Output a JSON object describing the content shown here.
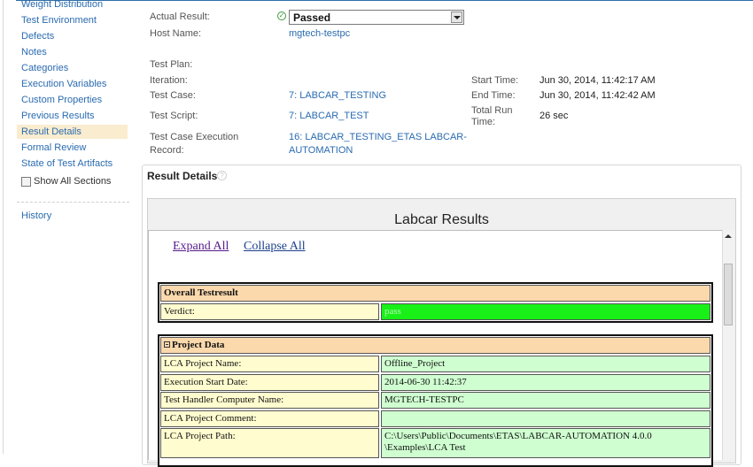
{
  "sidebar": {
    "items": [
      {
        "label": "Weight Distribution"
      },
      {
        "label": "Test Environment"
      },
      {
        "label": "Defects"
      },
      {
        "label": "Notes"
      },
      {
        "label": "Categories"
      },
      {
        "label": "Execution Variables"
      },
      {
        "label": "Custom Properties"
      },
      {
        "label": "Previous Results"
      },
      {
        "label": "Result Details"
      },
      {
        "label": "Formal Review"
      },
      {
        "label": "State of Test Artifacts"
      }
    ],
    "active": "Result Details",
    "show_all_label": "Show All Sections",
    "history_label": "History"
  },
  "fields": {
    "actual_result_label": "Actual Result:",
    "actual_result_value": "Passed",
    "host_name_label": "Host Name:",
    "host_name_value": "mgtech-testpc",
    "test_plan_label": "Test Plan:",
    "iteration_label": "Iteration:",
    "test_case_label": "Test Case:",
    "test_case_value": "7: LABCAR_TESTING",
    "test_script_label": "Test Script:",
    "test_script_value": "7: LABCAR_TEST",
    "tcer_label_1": "Test Case Execution",
    "tcer_label_2": "Record:",
    "tcer_value_1": "16: LABCAR_TESTING_ETAS LABCAR-",
    "tcer_value_2": "AUTOMATION",
    "start_time_label": "Start Time:",
    "start_time_value": "Jun 30, 2014, 11:42:17 AM",
    "end_time_label": "End Time:",
    "end_time_value": "Jun 30, 2014, 11:42:42 AM",
    "total_run_label_1": "Total Run",
    "total_run_label_2": "Time:",
    "total_run_value": "26 sec"
  },
  "result_details": {
    "title": "Result Details",
    "help": "?",
    "frame_title": "Labcar Results",
    "expand_all": "Expand All",
    "collapse_all": "Collapse All",
    "overall": {
      "header": "Overall Testresult",
      "verdict_label": "Verdict:",
      "verdict_value": "pass"
    },
    "project": {
      "header": "Project Data",
      "rows": [
        {
          "label": "LCA Project Name:",
          "value": "Offline_Project"
        },
        {
          "label": "Execution Start Date:",
          "value": "2014-06-30 11:42:37"
        },
        {
          "label": "Test Handler Computer Name:",
          "value": "MGTECH-TESTPC"
        },
        {
          "label": "LCA Project Comment:",
          "value": ""
        },
        {
          "label": "LCA Project Path:",
          "value": "C:\\Users\\Public\\Documents\\ETAS\\LABCAR-AUTOMATION 4.0.0",
          "value2": "\\Examples\\LCA Test"
        }
      ]
    }
  },
  "colors": {
    "link": "#2a6bb0",
    "active_bg": "#f9eccf",
    "header_bg": "#fbd9ad",
    "key_bg": "#fffccf",
    "value_bg": "#cfffd0",
    "pass_bg": "#18f018"
  }
}
